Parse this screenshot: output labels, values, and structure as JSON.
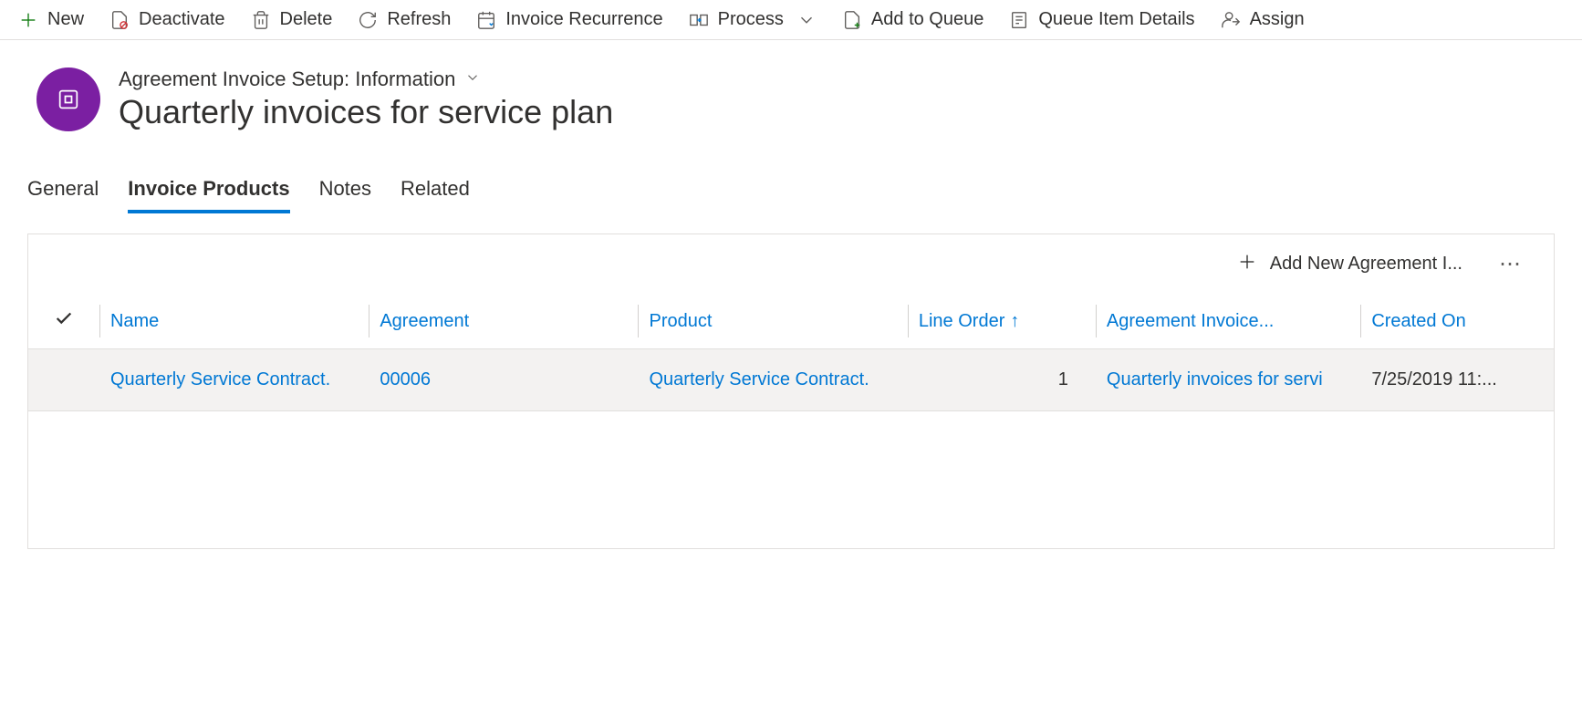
{
  "commandBar": {
    "new": "New",
    "deactivate": "Deactivate",
    "delete": "Delete",
    "refresh": "Refresh",
    "invoiceRecurrence": "Invoice Recurrence",
    "process": "Process",
    "addToQueue": "Add to Queue",
    "queueItemDetails": "Queue Item Details",
    "assign": "Assign"
  },
  "header": {
    "formLabel": "Agreement Invoice Setup: Information",
    "title": "Quarterly invoices for service plan"
  },
  "tabs": {
    "general": "General",
    "invoiceProducts": "Invoice Products",
    "notes": "Notes",
    "related": "Related"
  },
  "grid": {
    "addNew": "Add New Agreement I...",
    "columns": {
      "name": "Name",
      "agreement": "Agreement",
      "product": "Product",
      "lineOrder": "Line Order",
      "agreementInvoice": "Agreement Invoice...",
      "createdOn": "Created On"
    },
    "rows": [
      {
        "name": "Quarterly Service Contract.",
        "agreement": "00006",
        "product": "Quarterly Service Contract.",
        "lineOrder": "1",
        "agreementInvoice": "Quarterly invoices for servi",
        "createdOn": "7/25/2019 11:..."
      }
    ]
  }
}
